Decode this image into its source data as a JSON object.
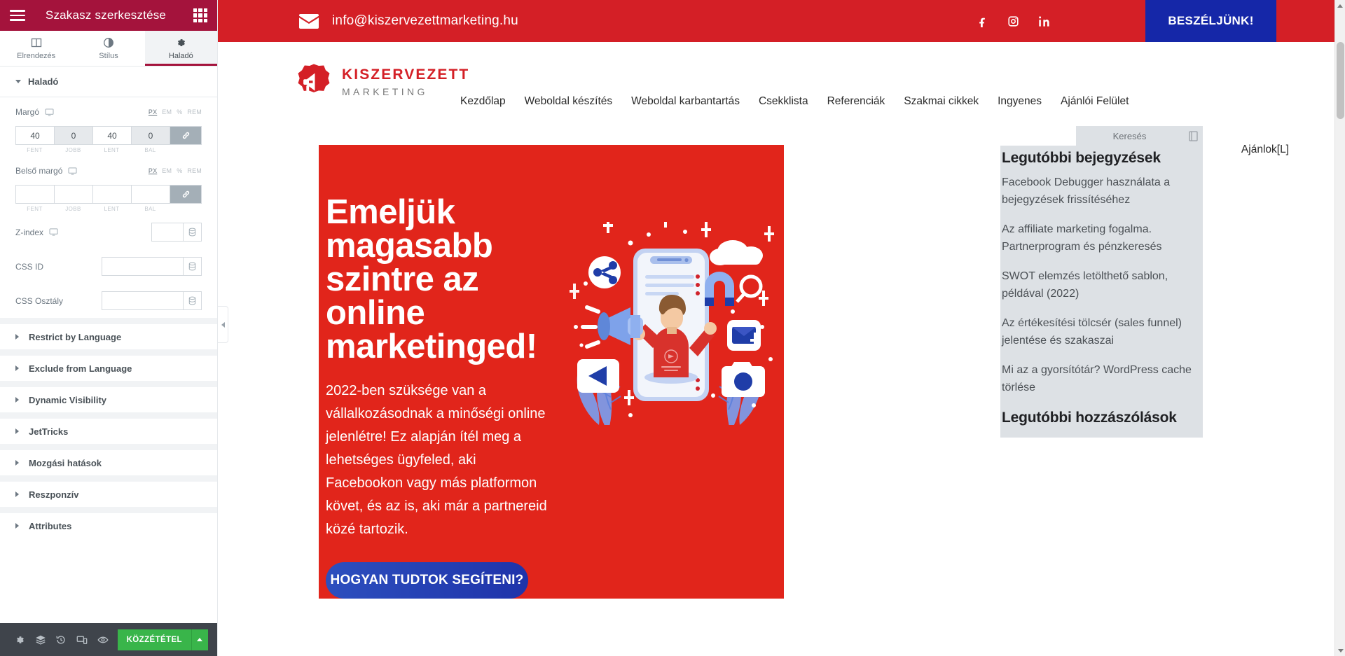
{
  "editor": {
    "header": {
      "title": "Szakasz szerkesztése",
      "menu_icon": "hamburger-icon",
      "grid_icon": "grid-icon"
    },
    "tabs": [
      {
        "label": "Elrendezés",
        "icon": "layout-icon",
        "active": false
      },
      {
        "label": "Stílus",
        "icon": "contrast-icon",
        "active": false
      },
      {
        "label": "Haladó",
        "icon": "gear-icon",
        "active": true
      }
    ],
    "section": {
      "title": "Haladó"
    },
    "margin": {
      "label": "Margó",
      "device_icon": "desktop-icon",
      "units": [
        "PX",
        "EM",
        "%",
        "REM"
      ],
      "active_unit": "PX",
      "values": [
        "40",
        "0",
        "40",
        "0"
      ],
      "sublabels": [
        "FENT",
        "JOBB",
        "LENT",
        "BAL"
      ],
      "link_icon": "link-icon"
    },
    "padding": {
      "label": "Belső margó",
      "device_icon": "desktop-icon",
      "units": [
        "PX",
        "EM",
        "%",
        "REM"
      ],
      "active_unit": "PX",
      "values": [
        "",
        "",
        "",
        ""
      ],
      "sublabels": [
        "FENT",
        "JOBB",
        "LENT",
        "BAL"
      ],
      "link_icon": "link-icon"
    },
    "fields": [
      {
        "label": "Z-index",
        "value": "",
        "device_icon": "desktop-icon",
        "dynamic_icon": "database-icon",
        "size": "sm"
      },
      {
        "label": "CSS ID",
        "value": "",
        "device_icon": "",
        "dynamic_icon": "database-icon",
        "size": "lg"
      },
      {
        "label": "CSS Osztály",
        "value": "",
        "device_icon": "",
        "dynamic_icon": "database-icon",
        "size": "lg"
      }
    ],
    "accordions": [
      "Restrict by Language",
      "Exclude from Language",
      "Dynamic Visibility",
      "JetTricks",
      "Mozgási hatások",
      "Reszponzív",
      "Attributes"
    ],
    "footer": {
      "icons": [
        "settings-gear-icon",
        "navigator-layers-icon",
        "history-clock-icon",
        "responsive-mode-icon",
        "preview-eye-icon"
      ],
      "publish_label": "KÖZZÉTÉTEL",
      "publish_arrow_icon": "chevron-up-icon",
      "publish_color": "#39b54a"
    },
    "collapse_handle_icon": "chevron-right-icon"
  },
  "site": {
    "topbar": {
      "email": "info@kiszervezettmarketing.hu",
      "mail_icon": "envelope-icon",
      "social": [
        {
          "name": "facebook-icon",
          "glyph": "f"
        },
        {
          "name": "instagram-icon",
          "glyph": "ig"
        },
        {
          "name": "linkedin-icon",
          "glyph": "in"
        }
      ],
      "cta_label": "BESZÉLJÜNK!",
      "bg_color": "#d41f26",
      "cta_color": "#1527a8"
    },
    "logo": {
      "line1": "KISZERVEZETT",
      "line2": "MARKETING",
      "mark_icon": "megaphone-badge-icon",
      "color": "#d41f26"
    },
    "nav": [
      "Kezdőlap",
      "Weboldal készítés",
      "Weboldal karbantartás",
      "Csekklista",
      "Referenciák",
      "Szakmai cikkek",
      "Ingyenes",
      "Ajánlói Felület"
    ],
    "header_right_link": "Ajánlok[L]",
    "hero": {
      "heading": "Emeljük magasabb szintre az online marketinged!",
      "paragraph": "2022-ben szüksége van a vállalkozásodnak a minőségi online jelenlétre! Ez alapján ítél meg a lehetséges ügyfeled, aki Facebookon vagy más platformon követ, és az is, aki már a partnereid közé tartozik.",
      "button_label": "HOGYAN TUDTOK SEGÍTENI?",
      "bg_color": "#e1251b",
      "button_color": "#2440b5",
      "illustration_icon": "marketing-megaphone-phone-illustration"
    },
    "sidebar": {
      "search_placeholder": "Keresés",
      "search_button_icon": "search-icon",
      "recent_posts_title": "Legutóbbi bejegyzések",
      "recent_posts": [
        "Facebook Debugger használata a bejegyzések frissítéséhez",
        "Az affiliate marketing fogalma. Partnerprogram és pénzkeresés",
        "SWOT elemzés letölthető sablon, példával (2022)",
        "Az értékesítési tölcsér (sales funnel) jelentése és szakaszai",
        "Mi az a gyorsítótár? WordPress cache törlése"
      ],
      "recent_comments_title": "Legutóbbi hozzászólások"
    },
    "scrollbar": {
      "up_icon": "scroll-up-arrow-icon",
      "down_icon": "scroll-down-arrow-icon"
    }
  }
}
